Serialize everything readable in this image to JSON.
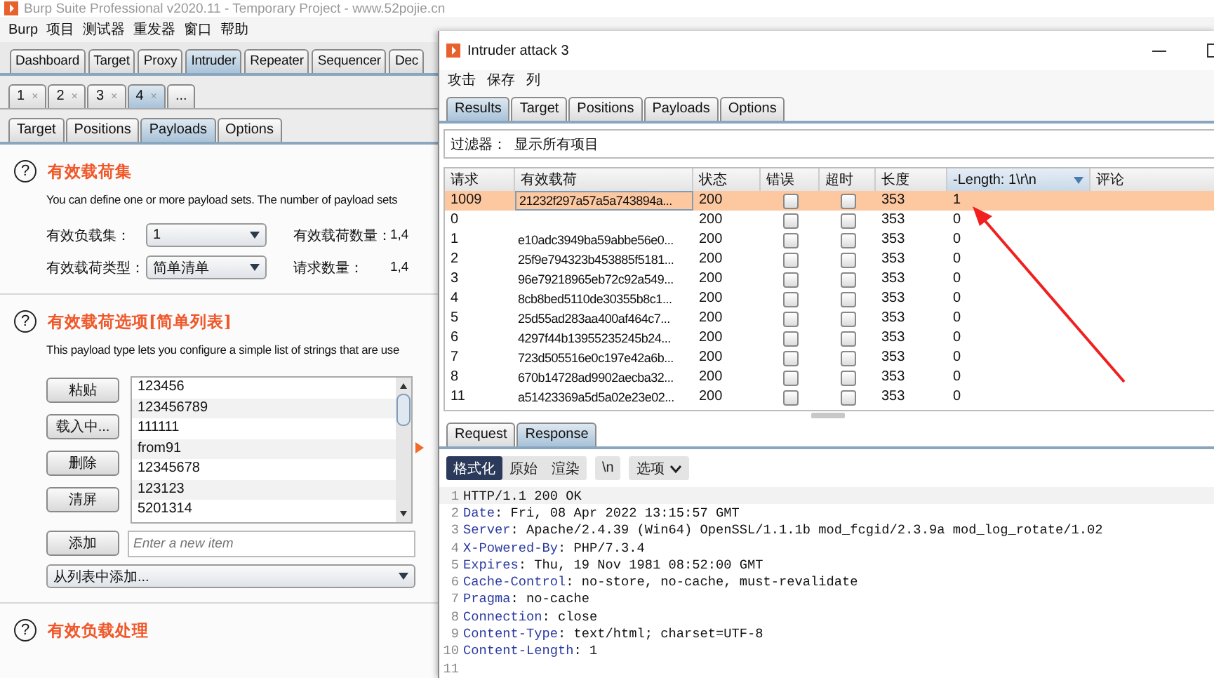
{
  "main_window": {
    "title": "Burp Suite Professional v2020.11 - Temporary Project - www.52pojie.cn",
    "menu": [
      "Burp",
      "项目",
      "测试器",
      "重发器",
      "窗口",
      "帮助"
    ],
    "tabs": [
      {
        "label": "Dashboard",
        "selected": false
      },
      {
        "label": "Target",
        "selected": false
      },
      {
        "label": "Proxy",
        "selected": false
      },
      {
        "label": "Intruder",
        "selected": true
      },
      {
        "label": "Repeater",
        "selected": false
      },
      {
        "label": "Sequencer",
        "selected": false
      },
      {
        "label": "Dec",
        "selected": false
      }
    ],
    "attack_tabs": [
      {
        "label": "1",
        "close": "×",
        "selected": false
      },
      {
        "label": "2",
        "close": "×",
        "selected": false
      },
      {
        "label": "3",
        "close": "×",
        "selected": false
      },
      {
        "label": "4",
        "close": "×",
        "selected": true
      },
      {
        "label": "...",
        "selected": false
      }
    ],
    "intruder_tabs": [
      {
        "label": "Target",
        "selected": false
      },
      {
        "label": "Positions",
        "selected": false
      },
      {
        "label": "Payloads",
        "selected": true
      },
      {
        "label": "Options",
        "selected": false
      }
    ],
    "payload_sets": {
      "help": "?",
      "title": "有效载荷集",
      "description": "You can define one or more payload sets. The number of payload sets",
      "fields": [
        {
          "label": "有效负载集：",
          "value": "1",
          "info_label": "有效载荷数量：",
          "info_value": "1,4"
        },
        {
          "label": "有效载荷类型：",
          "value": "简单清单",
          "info_label": "请求数量：",
          "info_value": "1,4"
        }
      ]
    },
    "payload_options": {
      "help": "?",
      "title": "有效载荷选项[简单列表]",
      "description": "This payload type lets you configure a simple list of strings that are use",
      "buttons": [
        "粘贴",
        "载入中...",
        "删除",
        "清屏"
      ],
      "items": [
        "123456",
        "123456789",
        "111111",
        "from91",
        "12345678",
        "123123",
        "5201314"
      ],
      "add_button": "添加",
      "add_placeholder": "Enter a new item",
      "add_from_list": "从列表中添加..."
    },
    "payload_processing": {
      "help": "?",
      "title": "有效负载处理"
    }
  },
  "attack_window": {
    "title": "Intruder attack 3",
    "menu": [
      "攻击",
      "保存",
      "列"
    ],
    "tabs": [
      {
        "label": "Results",
        "selected": true
      },
      {
        "label": "Target",
        "selected": false
      },
      {
        "label": "Positions",
        "selected": false
      },
      {
        "label": "Payloads",
        "selected": false
      },
      {
        "label": "Options",
        "selected": false
      }
    ],
    "filter": "过滤器：  显示所有项目",
    "table": {
      "columns": [
        {
          "label": "请求",
          "sorted": false
        },
        {
          "label": "有效载荷",
          "sorted": false
        },
        {
          "label": "状态",
          "sorted": false
        },
        {
          "label": "错误",
          "sorted": false
        },
        {
          "label": "超时",
          "sorted": false
        },
        {
          "label": "长度",
          "sorted": false
        },
        {
          "label": "-Length: 1\\r\\n",
          "sorted": true
        },
        {
          "label": "评论",
          "sorted": false
        }
      ],
      "rows": [
        {
          "request": "1009",
          "payload": "21232f297a57a5a743894a...",
          "status": "200",
          "error": false,
          "timeout": false,
          "length": "353",
          "match": "1",
          "selected": true
        },
        {
          "request": "0",
          "status": "200",
          "error": false,
          "timeout": false,
          "length": "353",
          "match": "0",
          "selected": false
        },
        {
          "request": "1",
          "payload": "e10adc3949ba59abbe56e0...",
          "status": "200",
          "error": false,
          "timeout": false,
          "length": "353",
          "match": "0",
          "selected": false
        },
        {
          "request": "2",
          "payload": "25f9e794323b453885f5181...",
          "status": "200",
          "error": false,
          "timeout": false,
          "length": "353",
          "match": "0",
          "selected": false
        },
        {
          "request": "3",
          "payload": "96e79218965eb72c92a549...",
          "status": "200",
          "error": false,
          "timeout": false,
          "length": "353",
          "match": "0",
          "selected": false
        },
        {
          "request": "4",
          "payload": "8cb8bed5110de30355b8c1...",
          "status": "200",
          "error": false,
          "timeout": false,
          "length": "353",
          "match": "0",
          "selected": false
        },
        {
          "request": "5",
          "payload": "25d55ad283aa400af464c7...",
          "status": "200",
          "error": false,
          "timeout": false,
          "length": "353",
          "match": "0",
          "selected": false
        },
        {
          "request": "6",
          "payload": "4297f44b13955235245b24...",
          "status": "200",
          "error": false,
          "timeout": false,
          "length": "353",
          "match": "0",
          "selected": false
        },
        {
          "request": "7",
          "payload": "723d505516e0c197e42a6b...",
          "status": "200",
          "error": false,
          "timeout": false,
          "length": "353",
          "match": "0",
          "selected": false
        },
        {
          "request": "8",
          "payload": "670b14728ad9902aecba32...",
          "status": "200",
          "error": false,
          "timeout": false,
          "length": "353",
          "match": "0",
          "selected": false
        },
        {
          "request": "11",
          "payload": "a51423369a5d5a02e23e02...",
          "status": "200",
          "error": false,
          "timeout": false,
          "length": "353",
          "match": "0",
          "selected": false
        }
      ]
    },
    "viewer_tabs": [
      {
        "label": "Request",
        "selected": false
      },
      {
        "label": "Response",
        "selected": true
      }
    ],
    "view_modes": [
      {
        "label": "格式化",
        "selected": true
      },
      {
        "label": "原始",
        "selected": false
      },
      {
        "label": "渲染",
        "selected": false
      }
    ],
    "newline_button": "\\n",
    "options_button": "选项",
    "lines": [
      {
        "number": "1",
        "value": "HTTP/1.1 200 OK"
      },
      {
        "number": "2",
        "name": "Date",
        "value": ": Fri, 08 Apr 2022 13:15:57 GMT"
      },
      {
        "number": "3",
        "name": "Server",
        "value": ": Apache/2.4.39 (Win64) OpenSSL/1.1.1b mod_fcgid/2.3.9a mod_log_rotate/1.02"
      },
      {
        "number": "4",
        "name": "X-Powered-By",
        "value": ": PHP/7.3.4"
      },
      {
        "number": "5",
        "name": "Expires",
        "value": ": Thu, 19 Nov 1981 08:52:00 GMT"
      },
      {
        "number": "6",
        "name": "Cache-Control",
        "value": ": no-store, no-cache, must-revalidate"
      },
      {
        "number": "7",
        "name": "Pragma",
        "value": ": no-cache"
      },
      {
        "number": "8",
        "name": "Connection",
        "value": ": close"
      },
      {
        "number": "9",
        "name": "Content-Type",
        "value": ": text/html; charset=UTF-8"
      },
      {
        "number": "10",
        "name": "Content-Length",
        "value": ": 1"
      },
      {
        "number": "11"
      }
    ]
  }
}
